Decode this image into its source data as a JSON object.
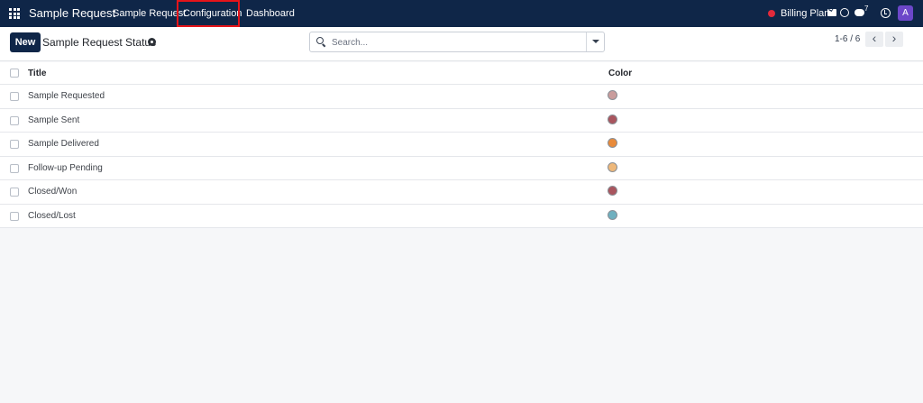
{
  "navbar": {
    "brand": "Sample Request",
    "menu": [
      {
        "label": "Sample Request"
      },
      {
        "label": "Configuration"
      },
      {
        "label": "Dashboard"
      }
    ],
    "billing_label": "Billing Plan",
    "chat_count": "7",
    "avatar_letter": "A",
    "colors": {
      "navbar_bg": "#0f2648",
      "billing_dot": "#e22a3b",
      "avatar_bg": "#6c47c9",
      "highlight": "#e5141a"
    }
  },
  "control": {
    "new_label": "New",
    "title": "Sample Request Status",
    "search_placeholder": "Search...",
    "pager": "1-6 / 6",
    "pager_prev": "‹",
    "pager_next": "›"
  },
  "list": {
    "columns": {
      "title": "Title",
      "color": "Color"
    },
    "rows": [
      {
        "title": "Sample Requested",
        "color": "#c99c9c"
      },
      {
        "title": "Sample Sent",
        "color": "#a9555e"
      },
      {
        "title": "Sample Delivered",
        "color": "#e88a3a"
      },
      {
        "title": "Follow-up Pending",
        "color": "#eeb87a"
      },
      {
        "title": "Closed/Won",
        "color": "#a9555e"
      },
      {
        "title": "Closed/Lost",
        "color": "#6fb0bf"
      }
    ]
  }
}
